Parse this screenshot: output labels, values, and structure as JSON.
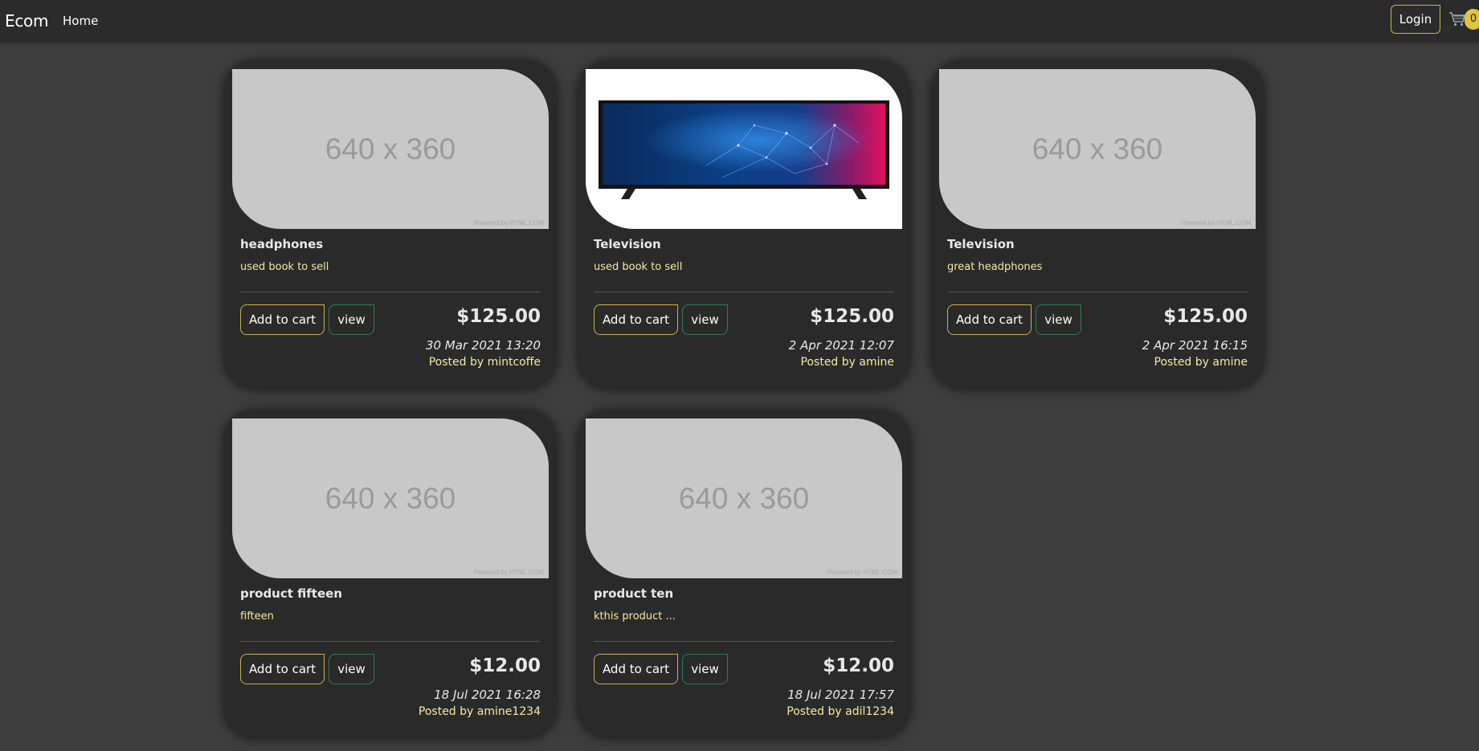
{
  "navbar": {
    "brand": "Ecom",
    "home": "Home",
    "login": "Login",
    "cart_count": "0",
    "cart_icon": "cart-icon"
  },
  "products": [
    {
      "title": "headphones",
      "description": "used book to sell",
      "price": "$125.00",
      "date": "30 Mar 2021 13:20",
      "posted_by": "Posted by mintcoffe",
      "image": "640 x 360",
      "image_footer": "Powered by HTML.COM",
      "add_to_cart": "Add to cart",
      "view": "view"
    },
    {
      "title": "Television",
      "description": "used book to sell",
      "price": "$125.00",
      "date": "2 Apr 2021 12:07",
      "posted_by": "Posted by amine",
      "image": "",
      "image_footer": "",
      "add_to_cart": "Add to cart",
      "view": "view"
    },
    {
      "title": "Television",
      "description": "great headphones",
      "price": "$125.00",
      "date": "2 Apr 2021 16:15",
      "posted_by": "Posted by amine",
      "image": "640 x 360",
      "image_footer": "Powered by HTML.COM",
      "add_to_cart": "Add to cart",
      "view": "view"
    },
    {
      "title": "product fifteen",
      "description": "fifteen",
      "price": "$12.00",
      "date": "18 Jul 2021 16:28",
      "posted_by": "Posted by amine1234",
      "image": "640 x 360",
      "image_footer": "Powered by HTML.COM",
      "add_to_cart": "Add to cart",
      "view": "view"
    },
    {
      "title": "product ten",
      "description": "kthis product ...",
      "price": "$12.00",
      "date": "18 Jul 2021 17:57",
      "posted_by": "Posted by adil1234",
      "image": "640 x 360",
      "image_footer": "Powered by HTML.COM",
      "add_to_cart": "Add to cart",
      "view": "view"
    }
  ],
  "colors": {
    "background": "#3d3d3d",
    "card": "#2a2a2a",
    "accent_yellow": "#c8b24a",
    "accent_green": "#2e7d5b",
    "desc_text": "#f4e9a0"
  }
}
